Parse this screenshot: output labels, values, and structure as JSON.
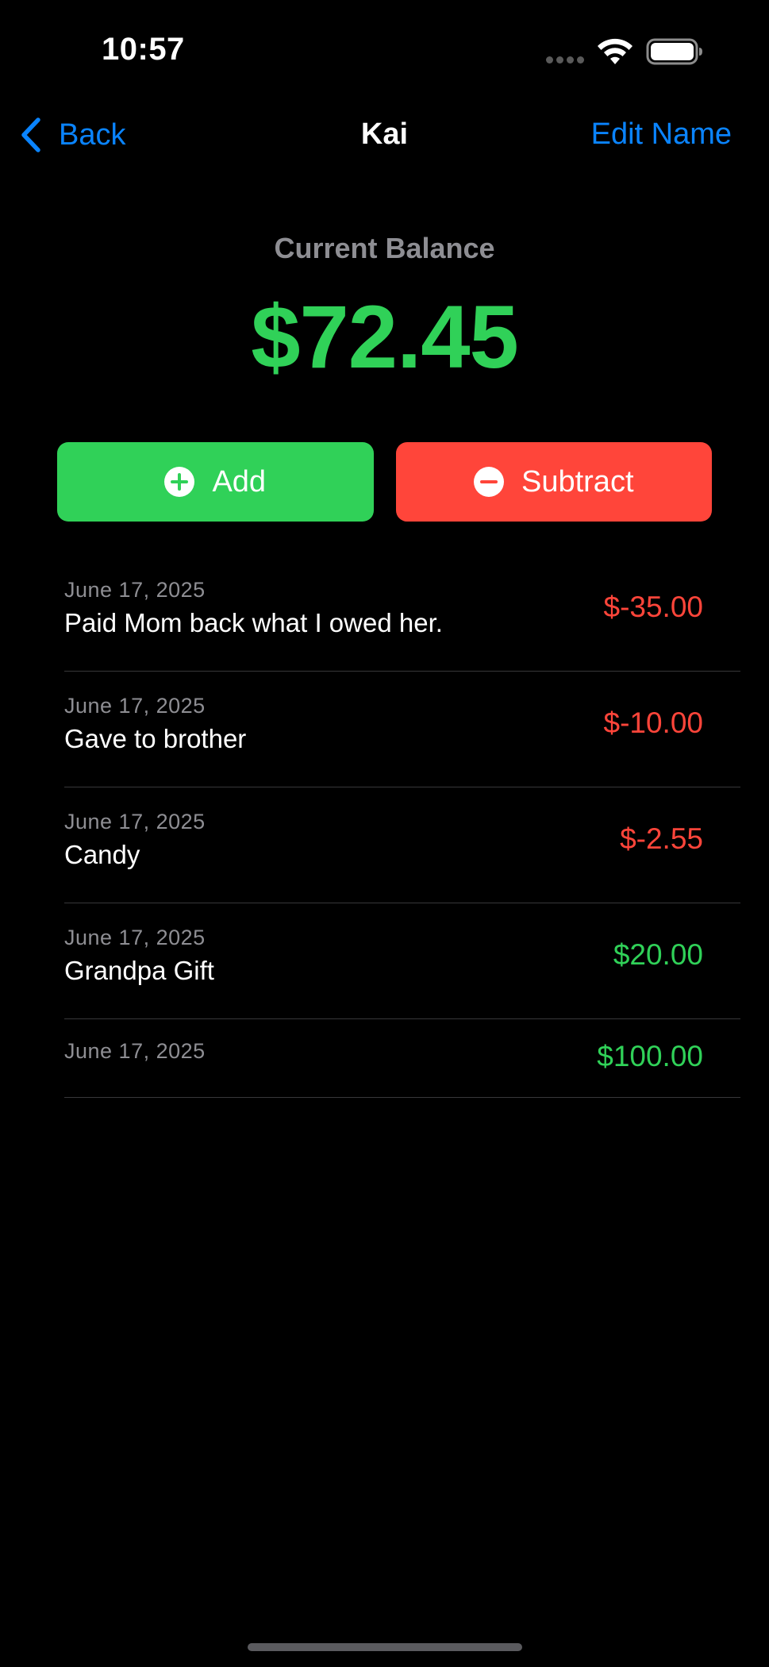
{
  "status_bar": {
    "time": "10:57"
  },
  "nav": {
    "back_label": "Back",
    "title": "Kai",
    "edit_label": "Edit Name"
  },
  "balance": {
    "label": "Current Balance",
    "amount": "$72.45"
  },
  "actions": {
    "add_label": "Add",
    "subtract_label": "Subtract"
  },
  "transactions": [
    {
      "date": "June 17, 2025",
      "description": "Paid Mom back what I owed her.",
      "amount": "$-35.00",
      "type": "negative"
    },
    {
      "date": "June 17, 2025",
      "description": "Gave to brother",
      "amount": "$-10.00",
      "type": "negative"
    },
    {
      "date": "June 17, 2025",
      "description": "Candy",
      "amount": "$-2.55",
      "type": "negative"
    },
    {
      "date": "June 17, 2025",
      "description": "Grandpa Gift",
      "amount": "$20.00",
      "type": "positive"
    },
    {
      "date": "June 17, 2025",
      "description": "",
      "amount": "$100.00",
      "type": "positive"
    }
  ],
  "colors": {
    "accent": "#0a84ff",
    "positive": "#30d158",
    "negative": "#ff453a",
    "background": "#000000",
    "secondary_text": "#8e8e93"
  },
  "icons": {
    "back": "chevron-left-icon",
    "add": "plus-circle-icon",
    "subtract": "minus-circle-icon",
    "wifi": "wifi-icon",
    "battery": "battery-icon"
  }
}
